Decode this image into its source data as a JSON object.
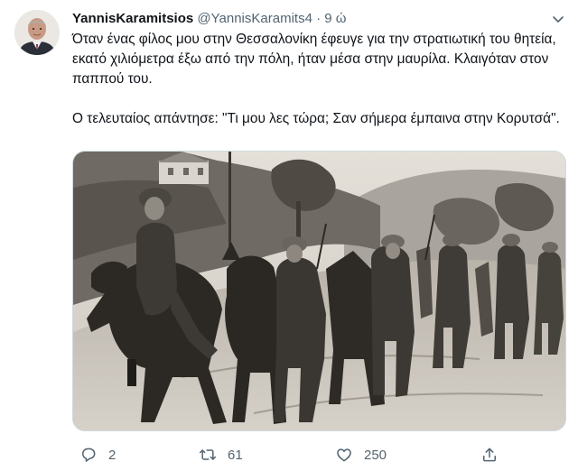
{
  "tweet": {
    "display_name": "YannisKaramitsios",
    "handle": "@YannisKaramits4",
    "separator": "·",
    "time": "9 ώ",
    "text_p1": "Όταν ένας φίλος μου στην Θεσσαλονίκη έφευγε για την στρατιωτική του θητεία, εκατό χιλιόμετρα έξω από την πόλη, ήταν μέσα στην μαυρίλα. Κλαιγόταν στον παππού του.",
    "text_p2": "Ο τελευταίος απάντησε: \"Τι μου λες τώρα; Σαν σήμερα έμπαινα στην Κορυτσά\".",
    "media_alt": "Black-and-white photograph of soldiers in helmets walking with mules on a muddy mountain road"
  },
  "actions": {
    "reply_count": "2",
    "retweet_count": "61",
    "like_count": "250"
  },
  "icons": {
    "caret": "chevron-down-icon",
    "reply": "reply-icon",
    "retweet": "retweet-icon",
    "like": "heart-icon",
    "share": "share-icon"
  },
  "colors": {
    "text": "#0f1419",
    "secondary": "#536471",
    "border": "#cfd9de"
  }
}
